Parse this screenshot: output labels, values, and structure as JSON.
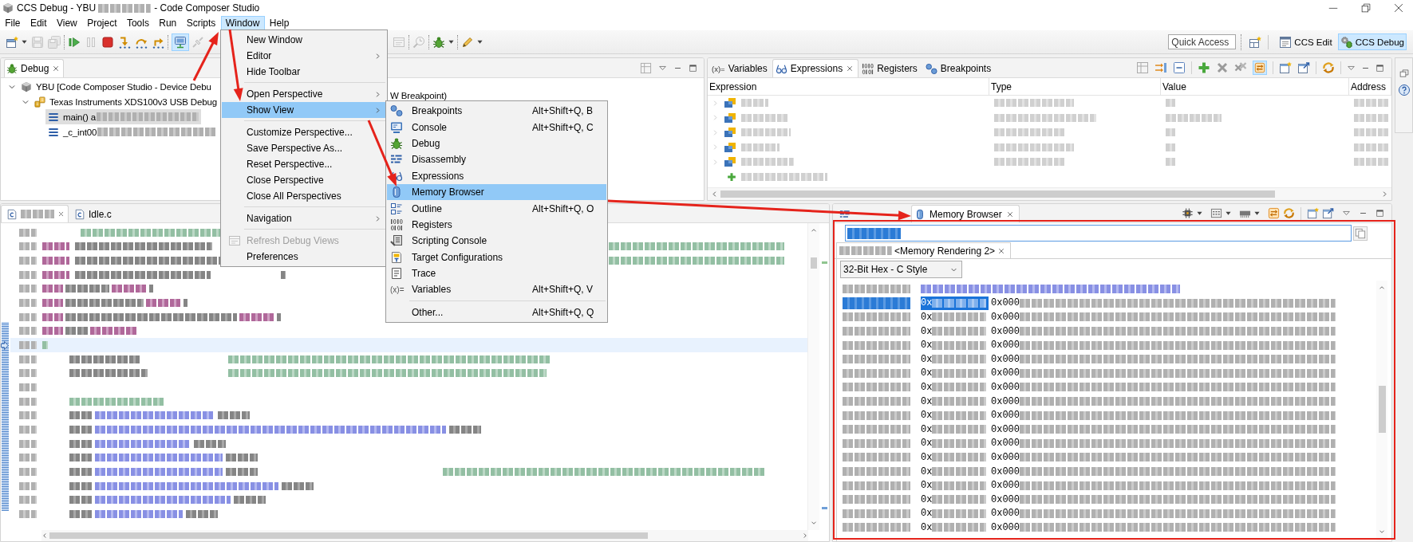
{
  "window": {
    "title_parts": [
      "CCS Debug - YBU",
      "- Code Composer Studio"
    ]
  },
  "menu_bar": [
    {
      "label": "File",
      "selected": false
    },
    {
      "label": "Edit",
      "selected": false
    },
    {
      "label": "View",
      "selected": false
    },
    {
      "label": "Project",
      "selected": false
    },
    {
      "label": "Tools",
      "selected": false
    },
    {
      "label": "Run",
      "selected": false
    },
    {
      "label": "Scripts",
      "selected": false
    },
    {
      "label": "Window",
      "selected": true
    },
    {
      "label": "Help",
      "selected": false
    }
  ],
  "toolbar": {
    "groups": [
      [
        {
          "kind": "new",
          "dropdown": true,
          "disabled": false,
          "selected": false
        },
        {
          "kind": "save",
          "dropdown": false,
          "disabled": true,
          "selected": false
        },
        {
          "kind": "save-all",
          "dropdown": false,
          "disabled": true,
          "selected": false
        }
      ],
      [
        {
          "kind": "resume",
          "dropdown": false,
          "disabled": false,
          "selected": false
        },
        {
          "kind": "suspend",
          "dropdown": false,
          "disabled": true,
          "selected": false
        },
        {
          "kind": "terminate",
          "dropdown": false,
          "disabled": false,
          "selected": false
        },
        {
          "kind": "step-into",
          "dropdown": false,
          "disabled": false,
          "selected": false
        },
        {
          "kind": "step-over",
          "dropdown": false,
          "disabled": false,
          "selected": false
        },
        {
          "kind": "step-return",
          "dropdown": false,
          "disabled": false,
          "selected": false
        }
      ],
      [
        {
          "kind": "connect",
          "dropdown": false,
          "disabled": false,
          "selected": true
        },
        {
          "kind": "disconnect",
          "dropdown": false,
          "disabled": true,
          "selected": false
        }
      ]
    ],
    "more_groups": [
      [
        {
          "kind": "window-lines",
          "dropdown": false,
          "disabled": true,
          "selected": false
        }
      ],
      [
        {
          "kind": "clock",
          "dropdown": false,
          "disabled": true,
          "selected": false
        }
      ],
      [
        {
          "kind": "bug",
          "dropdown": true,
          "disabled": false,
          "selected": false
        }
      ],
      [
        {
          "kind": "pencil",
          "dropdown": true,
          "disabled": false,
          "selected": false
        }
      ]
    ],
    "quick_access": {
      "placeholder": "Quick Access"
    },
    "perspectives": [
      {
        "kind": "edit",
        "label": "CCS Edit",
        "selected": false
      },
      {
        "kind": "debug",
        "label": "CCS Debug",
        "selected": true
      }
    ]
  },
  "debug_view": {
    "tab": {
      "label": "Debug",
      "selected": true
    },
    "tree": [
      {
        "kind": "session",
        "label": "YBU [Code Composer Studio - Device Debu",
        "expanded": true,
        "selected": false,
        "children": [
          {
            "kind": "probe",
            "label": "Texas Instruments XDS100v3 USB Debug",
            "tail": "W Breakpoint)",
            "expanded": true,
            "selected": false,
            "children": [
              {
                "kind": "frame",
                "label": "main() a",
                "selected": true
              },
              {
                "kind": "frame",
                "label": "_c_int00",
                "selected": false
              }
            ]
          }
        ]
      }
    ]
  },
  "expressions_view": {
    "tabs": [
      {
        "kind": "variables",
        "icon_text": "(x)=",
        "label": "Variables",
        "selected": false
      },
      {
        "kind": "expressions",
        "label": "Expressions",
        "selected": true
      },
      {
        "kind": "registers",
        "label": "Registers",
        "selected": false
      },
      {
        "kind": "breakpoints",
        "label": "Breakpoints",
        "selected": false
      }
    ],
    "tools": [
      [
        {
          "kind": "grid",
          "selected": false
        },
        {
          "kind": "arrows",
          "selected": false
        },
        {
          "kind": "collapse",
          "selected": false
        }
      ],
      [
        {
          "kind": "plus",
          "selected": false
        },
        {
          "kind": "remove",
          "selected": false
        },
        {
          "kind": "remove-all",
          "selected": false
        },
        {
          "kind": "arrows-box",
          "selected": true
        }
      ],
      [
        {
          "kind": "new-view",
          "selected": false
        },
        {
          "kind": "pin",
          "selected": false
        }
      ],
      [
        {
          "kind": "sync",
          "selected": false
        }
      ]
    ],
    "columns": [
      "Expression",
      "Type",
      "Value",
      "Address"
    ],
    "rows": [
      {
        "kind": "variable"
      },
      {
        "kind": "variable"
      },
      {
        "kind": "variable"
      },
      {
        "kind": "variable"
      },
      {
        "kind": "variable"
      },
      {
        "kind": "add"
      }
    ]
  },
  "editor": {
    "tabs": [
      {
        "kind": "c-file",
        "selected": true
      },
      {
        "kind": "c-file",
        "label": "Idle.c",
        "selected": false
      }
    ],
    "lines": [
      {
        "kind": "rule",
        "current": false
      },
      {
        "kind": "define-comment",
        "current": false
      },
      {
        "kind": "define-comment",
        "current": false
      },
      {
        "kind": "define",
        "current": false
      },
      {
        "kind": "declaration",
        "current": false
      },
      {
        "kind": "declaration",
        "current": false
      },
      {
        "kind": "declaration",
        "current": false
      },
      {
        "kind": "declaration",
        "current": false
      },
      {
        "kind": "brace",
        "current": true
      },
      {
        "kind": "call-comment",
        "current": false
      },
      {
        "kind": "call-comment",
        "current": false
      },
      {
        "kind": "blank",
        "current": false
      },
      {
        "kind": "comment",
        "current": false
      },
      {
        "kind": "assignment",
        "current": false
      },
      {
        "kind": "assignment",
        "current": false
      },
      {
        "kind": "assignment",
        "current": false
      },
      {
        "kind": "assignment",
        "current": false
      },
      {
        "kind": "assignment-comment",
        "current": false
      },
      {
        "kind": "assignment",
        "current": false
      },
      {
        "kind": "assignment",
        "current": false
      },
      {
        "kind": "assignment",
        "current": false
      }
    ]
  },
  "memory_view": {
    "tabs": [
      {
        "kind": "disassembly",
        "selected": false
      },
      {
        "kind": "memory",
        "label": "Memory Browser",
        "selected": true
      }
    ],
    "rendering_tab": {
      "label": "<Memory Rendering 2>",
      "selected": true
    },
    "format": "32-Bit Hex - C Style",
    "rows": [
      {
        "kind": "label",
        "selected": false
      },
      {
        "kind": "data",
        "selected": true,
        "cells": [
          "0x",
          "0x000"
        ]
      },
      {
        "kind": "data",
        "selected": false,
        "cells": [
          "0x",
          "0x000"
        ]
      },
      {
        "kind": "data",
        "selected": false,
        "cells": [
          "0x",
          "0x000"
        ]
      },
      {
        "kind": "data",
        "selected": false,
        "cells": [
          "0x",
          "0x000"
        ]
      },
      {
        "kind": "data",
        "selected": false,
        "cells": [
          "0x",
          "0x000"
        ]
      },
      {
        "kind": "data",
        "selected": false,
        "cells": [
          "0x",
          "0x000"
        ]
      },
      {
        "kind": "data",
        "selected": false,
        "cells": [
          "0x",
          "0x000"
        ]
      },
      {
        "kind": "data",
        "selected": false,
        "cells": [
          "0x",
          "0x000"
        ]
      },
      {
        "kind": "data",
        "selected": false,
        "cells": [
          "0x",
          "0x000"
        ]
      },
      {
        "kind": "data",
        "selected": false,
        "cells": [
          "0x",
          "0x000"
        ]
      },
      {
        "kind": "data",
        "selected": false,
        "cells": [
          "0x",
          "0x000"
        ]
      },
      {
        "kind": "data",
        "selected": false,
        "cells": [
          "0x",
          "0x000"
        ]
      },
      {
        "kind": "data",
        "selected": false,
        "cells": [
          "0x",
          "0x000"
        ]
      },
      {
        "kind": "data",
        "selected": false,
        "cells": [
          "0x",
          "0x000"
        ]
      },
      {
        "kind": "data",
        "selected": false,
        "cells": [
          "0x",
          "0x000"
        ]
      },
      {
        "kind": "data",
        "selected": false,
        "cells": [
          "0x",
          "0x000"
        ]
      },
      {
        "kind": "data",
        "selected": false,
        "cells": [
          "0x",
          "0x000"
        ]
      }
    ]
  },
  "window_menu": {
    "groups": [
      [
        {
          "label": "New Window",
          "kind": "plain",
          "submenu": false,
          "selected": false,
          "disabled": false
        },
        {
          "label": "Editor",
          "kind": "plain",
          "submenu": true,
          "selected": false,
          "disabled": false
        },
        {
          "label": "Hide Toolbar",
          "kind": "plain",
          "submenu": false,
          "selected": false,
          "disabled": false
        }
      ],
      [
        {
          "label": "Open Perspective",
          "kind": "plain",
          "submenu": true,
          "selected": false,
          "disabled": false
        },
        {
          "label": "Show View",
          "kind": "plain",
          "submenu": true,
          "selected": true,
          "disabled": false
        }
      ],
      [
        {
          "label": "Customize Perspective...",
          "kind": "plain",
          "submenu": false,
          "selected": false,
          "disabled": false
        },
        {
          "label": "Save Perspective As...",
          "kind": "plain",
          "submenu": false,
          "selected": false,
          "disabled": false
        },
        {
          "label": "Reset Perspective...",
          "kind": "plain",
          "submenu": false,
          "selected": false,
          "disabled": false
        },
        {
          "label": "Close Perspective",
          "kind": "plain",
          "submenu": false,
          "selected": false,
          "disabled": false
        },
        {
          "label": "Close All Perspectives",
          "kind": "plain",
          "submenu": false,
          "selected": false,
          "disabled": false
        }
      ],
      [
        {
          "label": "Navigation",
          "kind": "plain",
          "submenu": true,
          "selected": false,
          "disabled": false
        }
      ],
      [
        {
          "label": "Refresh Debug Views",
          "kind": "window",
          "submenu": false,
          "selected": false,
          "disabled": true
        },
        {
          "label": "Preferences",
          "kind": "plain",
          "submenu": false,
          "selected": false,
          "disabled": false
        }
      ]
    ]
  },
  "show_view_menu": {
    "groups": [
      [
        {
          "label": "Breakpoints",
          "kind": "breakpoints",
          "shortcut": "Alt+Shift+Q, B",
          "selected": false
        },
        {
          "label": "Console",
          "kind": "console",
          "shortcut": "Alt+Shift+Q, C",
          "selected": false
        },
        {
          "label": "Debug",
          "kind": "debug",
          "selected": false
        },
        {
          "label": "Disassembly",
          "kind": "disassembly",
          "selected": false
        },
        {
          "label": "Expressions",
          "kind": "expressions",
          "selected": false
        },
        {
          "label": "Memory Browser",
          "kind": "memory",
          "selected": true
        },
        {
          "label": "Outline",
          "kind": "outline",
          "shortcut": "Alt+Shift+Q, O",
          "selected": false
        },
        {
          "label": "Registers",
          "kind": "registers",
          "selected": false
        },
        {
          "label": "Scripting Console",
          "kind": "scripting",
          "selected": false
        },
        {
          "label": "Target Configurations",
          "kind": "target",
          "selected": false
        },
        {
          "label": "Trace",
          "kind": "trace",
          "selected": false
        },
        {
          "label": "Variables",
          "kind": "variables",
          "icon_text": "(x)=",
          "shortcut": "Alt+Shift+Q, V",
          "selected": false
        }
      ],
      [
        {
          "label": "Other...",
          "kind": "plain",
          "shortcut": "Alt+Shift+Q, Q",
          "selected": false
        }
      ]
    ]
  },
  "annotations": [
    {
      "kind": "arrow"
    },
    {
      "kind": "arrow"
    },
    {
      "kind": "arrow"
    },
    {
      "kind": "arrow"
    },
    {
      "kind": "frame"
    }
  ]
}
